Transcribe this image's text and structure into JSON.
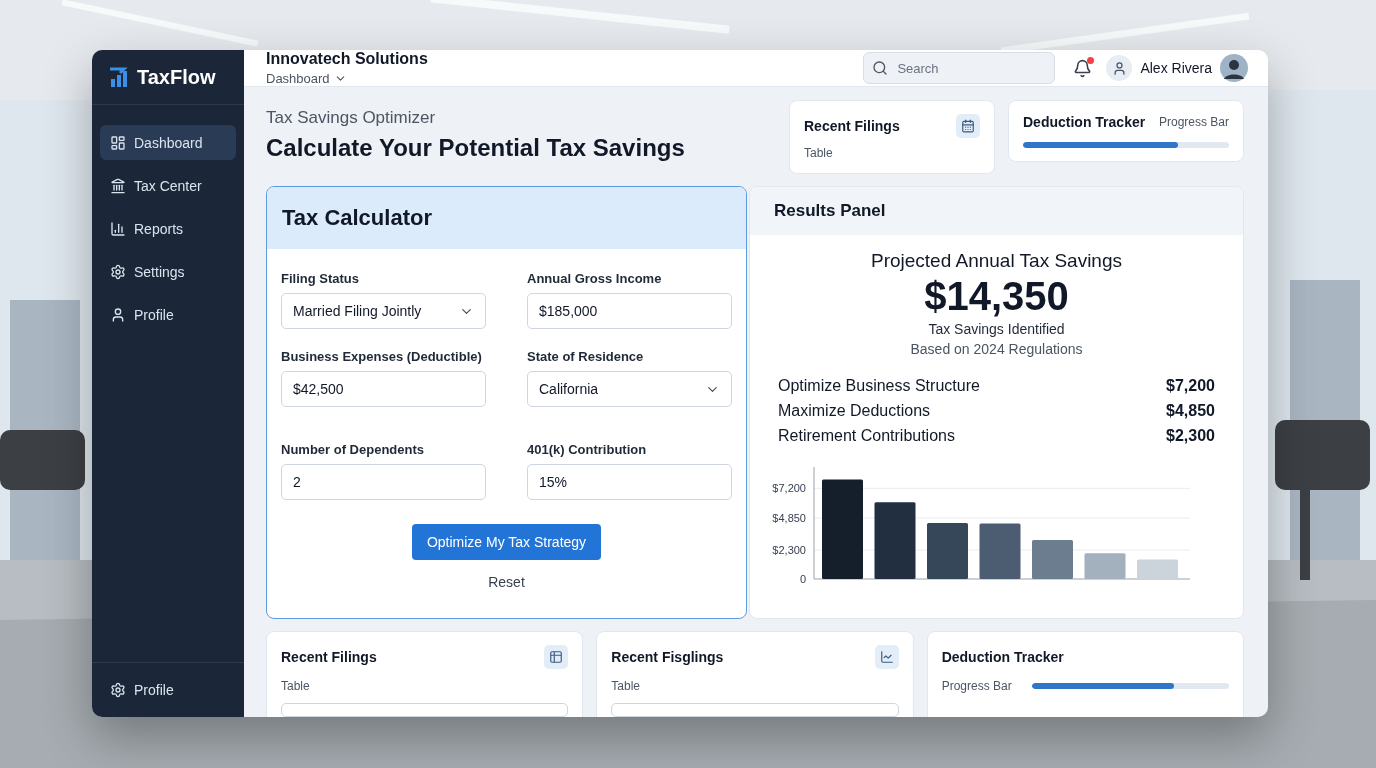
{
  "app": {
    "logo": "TaxFlow"
  },
  "sidebar": {
    "items": [
      {
        "label": "Dashboard",
        "selected": true
      },
      {
        "label": "Tax Center",
        "selected": false
      },
      {
        "label": "Reports",
        "selected": false
      },
      {
        "label": "Settings",
        "selected": false
      },
      {
        "label": "Profile",
        "selected": false
      }
    ],
    "footer": {
      "label": "Profile"
    }
  },
  "header": {
    "company": "Innovatech Solutions",
    "breadcrumb": "Dashboard",
    "search": {
      "placeholder": "Search"
    },
    "notifications": {
      "unread": true
    },
    "user": {
      "name": "Alex Rivera"
    }
  },
  "page": {
    "eyebrow": "Tax Savings Optimizer",
    "title": "Calculate Your Potential Tax Savings"
  },
  "top_widgets": [
    {
      "kind": "table",
      "title": "Recent Filings",
      "caption": "Table"
    },
    {
      "kind": "progress",
      "title": "Deduction Tracker",
      "caption": "Progress Bar",
      "level": 0.75
    }
  ],
  "calculator": {
    "title": "Tax Calculator",
    "fields": [
      {
        "kind": "select",
        "label": "Filing Status",
        "value": "Married Filing Jointly"
      },
      {
        "kind": "input",
        "label": "Annual Gross Income",
        "value": "$185,000"
      },
      {
        "kind": "input",
        "label": "Business Expenses (Deductible)",
        "value": "$42,500"
      },
      {
        "kind": "select",
        "label": "State of Residence",
        "value": "California"
      },
      {
        "kind": "input",
        "label": "Number of Dependents",
        "value": "2"
      },
      {
        "kind": "input",
        "label": "401(k) Contribution",
        "value": "15%"
      }
    ],
    "primary_button": "Optimize My Tax Strategy",
    "secondary_button": "Reset"
  },
  "results": {
    "title": "Results Panel",
    "headline": "Projected Annual Tax Savings",
    "amount": "$14,350",
    "amount_caption": "Tax Savings Identified",
    "basis": "Based on 2024 Regulations",
    "breakdown": [
      {
        "label": "Optimize Business Structure",
        "value": "$7,200"
      },
      {
        "label": "Maximize Deductions",
        "value": "$4,850"
      },
      {
        "label": "Retirement Contributions",
        "value": "$2,300"
      }
    ],
    "chart_data": {
      "type": "bar",
      "grid": true,
      "ylim": [
        0,
        8100
      ],
      "yticks": [
        {
          "value": 0,
          "label": "0"
        },
        {
          "value": 2300,
          "label": "$2,300"
        },
        {
          "value": 4850,
          "label": "$4,850"
        },
        {
          "value": 7200,
          "label": "$7,200"
        }
      ],
      "values": [
        7900,
        6100,
        4450,
        4400,
        3100,
        2050,
        1550
      ]
    }
  },
  "bottom_widgets": [
    {
      "kind": "table",
      "title": "Recent Filings",
      "caption": "Table"
    },
    {
      "kind": "chart",
      "title": "Recent Fisglings",
      "caption": "Table"
    },
    {
      "kind": "progress",
      "title": "Deduction Tracker",
      "caption": "Progress Bar",
      "level": 0.72
    }
  ]
}
